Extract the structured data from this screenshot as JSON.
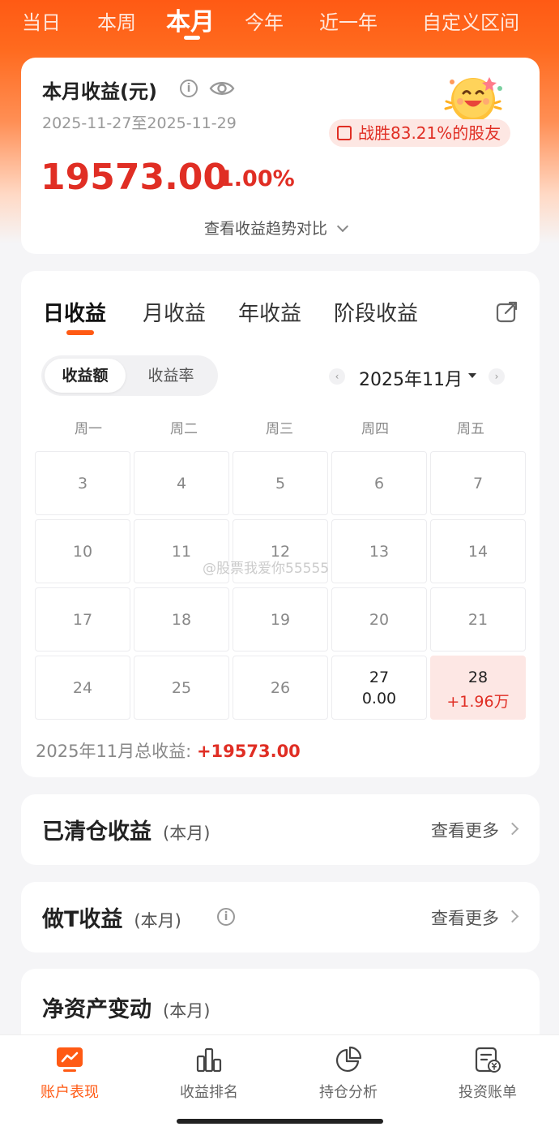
{
  "period_tabs": [
    {
      "label": "当日",
      "active": false
    },
    {
      "label": "本周",
      "active": false
    },
    {
      "label": "本月",
      "active": true
    },
    {
      "label": "今年",
      "active": false
    },
    {
      "label": "近一年",
      "active": false
    },
    {
      "label": "自定义区间",
      "active": false
    }
  ],
  "summary": {
    "title": "本月收益(元)",
    "date_range": "2025-11-27至2025-11-29",
    "beat_text": "战胜83.21%的股友",
    "profit_value": "19573.00",
    "profit_pct": "1.00%",
    "trend_link": "查看收益趋势对比"
  },
  "calendar": {
    "tabs": [
      {
        "label": "日收益",
        "active": true
      },
      {
        "label": "月收益",
        "active": false
      },
      {
        "label": "年收益",
        "active": false
      },
      {
        "label": "阶段收益",
        "active": false
      }
    ],
    "toggle": {
      "amount": "收益额",
      "rate": "收益率",
      "selected": "amount"
    },
    "month": "2025年11月",
    "weekdays": [
      "周一",
      "周二",
      "周三",
      "周四",
      "周五"
    ],
    "weeks": [
      [
        {
          "day": "3"
        },
        {
          "day": "4"
        },
        {
          "day": "5"
        },
        {
          "day": "6"
        },
        {
          "day": "7"
        }
      ],
      [
        {
          "day": "10"
        },
        {
          "day": "11"
        },
        {
          "day": "12"
        },
        {
          "day": "13"
        },
        {
          "day": "14"
        }
      ],
      [
        {
          "day": "17"
        },
        {
          "day": "18"
        },
        {
          "day": "19"
        },
        {
          "day": "20"
        },
        {
          "day": "21"
        }
      ],
      [
        {
          "day": "24"
        },
        {
          "day": "25"
        },
        {
          "day": "26"
        },
        {
          "day": "27",
          "value": "0.00"
        },
        {
          "day": "28",
          "value": "+1.96万",
          "profit": true
        }
      ]
    ],
    "total_label": "2025年11月总收益:",
    "total_value": "+19573.00"
  },
  "watermark": "@股票我爱你55555",
  "sections": {
    "cleared": {
      "title": "已清仓收益",
      "sub": "(本月)",
      "more": "查看更多"
    },
    "t_trade": {
      "title": "做T收益",
      "sub": "(本月)",
      "more": "查看更多"
    },
    "net_asset": {
      "title": "净资产变动",
      "sub": "(本月)"
    }
  },
  "bottom_nav": [
    {
      "label": "账户表现",
      "icon": "monitor-chart-icon",
      "active": true
    },
    {
      "label": "收益排名",
      "icon": "bar-chart-icon",
      "active": false
    },
    {
      "label": "持仓分析",
      "icon": "pie-chart-icon",
      "active": false
    },
    {
      "label": "投资账单",
      "icon": "bill-yen-icon",
      "active": false
    }
  ],
  "colors": {
    "accent": "#ff5a14",
    "profit_red": "#e02e24"
  }
}
